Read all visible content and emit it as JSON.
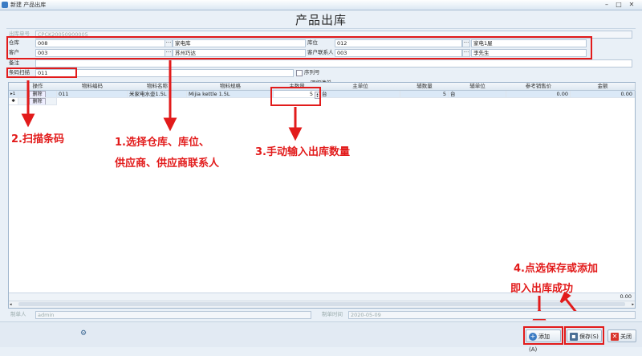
{
  "window": {
    "title": "新建 产品出库"
  },
  "form": {
    "title": "产品出库",
    "doc_no_label": "出库单号",
    "doc_no_value": "CPCK20050900005",
    "warehouse_label": "仓库",
    "warehouse_code": "008",
    "warehouse_name": "家电库",
    "location_label": "库位",
    "location_code": "012",
    "location_name": "家电1屋",
    "customer_label": "客户",
    "customer_code": "003",
    "customer_name": "苏州巧达",
    "contact_label": "客户联系人",
    "contact_code": "003",
    "contact_name": "李先生",
    "remark_label": "备注",
    "barcode_label": "条码扫描",
    "barcode_value": "011",
    "serial_label": "序列号",
    "detail_caption": "明细清单"
  },
  "grid": {
    "headers": [
      "操作",
      "物料编码",
      "物料名称",
      "物料规格",
      "主数量",
      "主单位",
      "辅数量",
      "辅单位",
      "参考销售价",
      "金额"
    ],
    "rows": [
      {
        "marker": "▸1",
        "action": "删除",
        "code": "011",
        "name": "米家电水壶1.5L",
        "spec": "Mijia kettle 1.5L",
        "qty": "5",
        "unit": "台",
        "aux_qty": "5",
        "aux_unit": "台",
        "price": "0.00",
        "amount": "0.00"
      }
    ],
    "new_row": {
      "marker": "✱",
      "action": "删除"
    },
    "footer_amount": "0.00"
  },
  "footer": {
    "creator_label": "制单人",
    "creator_value": "admin",
    "date_label": "制单时间",
    "date_value": "2020-05-09"
  },
  "buttons": {
    "add": "添加(A)",
    "save": "保存(S)",
    "close": "关闭"
  },
  "annotations": {
    "a1_line1": "1.选择仓库、库位、",
    "a1_line2": "供应商、供应商联系人",
    "a2": "2.扫描条码",
    "a3": "3.手动输入出库数量",
    "a4_line1": "4.点选保存或添加",
    "a4_line2": "即入出库成功"
  },
  "colors": {
    "annotation": "#e21b1b",
    "accent": "#3b7cc4"
  }
}
